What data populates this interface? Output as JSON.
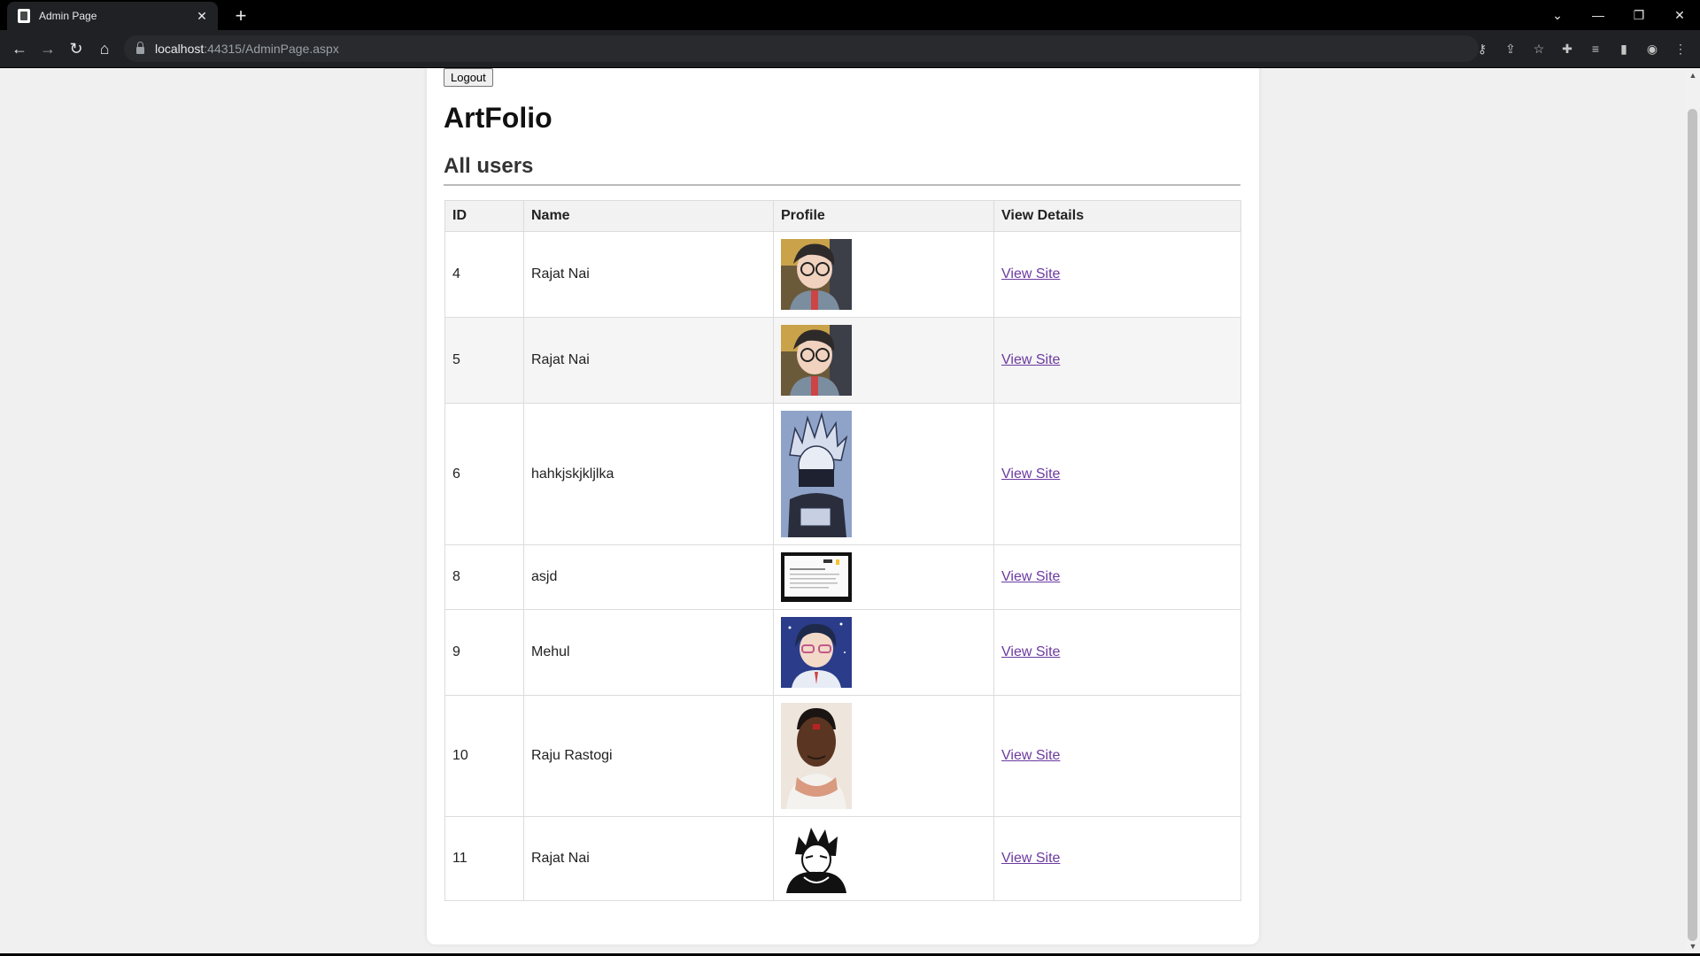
{
  "browser": {
    "tab_title": "Admin Page",
    "tab_close": "✕",
    "new_tab": "+",
    "url_host": "localhost",
    "url_rest": ":44315/AdminPage.aspx"
  },
  "page": {
    "logout_label": "Logout",
    "brand": "ArtFolio",
    "section_title": "All users"
  },
  "table": {
    "headers": [
      "ID",
      "Name",
      "Profile",
      "View Details"
    ],
    "link_label": "View Site",
    "rows": [
      {
        "id": "4",
        "name": "Rajat Nai",
        "avatar": "anime-boy-glasses"
      },
      {
        "id": "5",
        "name": "Rajat Nai",
        "avatar": "anime-boy-glasses"
      },
      {
        "id": "6",
        "name": "hahkjskjkljlka",
        "avatar": "manga-ninja"
      },
      {
        "id": "8",
        "name": "asjd",
        "avatar": "document-screenshot"
      },
      {
        "id": "9",
        "name": "Mehul",
        "avatar": "anime-boy-blue"
      },
      {
        "id": "10",
        "name": "Raju Rastogi",
        "avatar": "man-photo"
      },
      {
        "id": "11",
        "name": "Rajat Nai",
        "avatar": "manga-sketch"
      }
    ]
  },
  "colors": {
    "link": "#6b3aa0",
    "chrome_dark": "#202124"
  }
}
